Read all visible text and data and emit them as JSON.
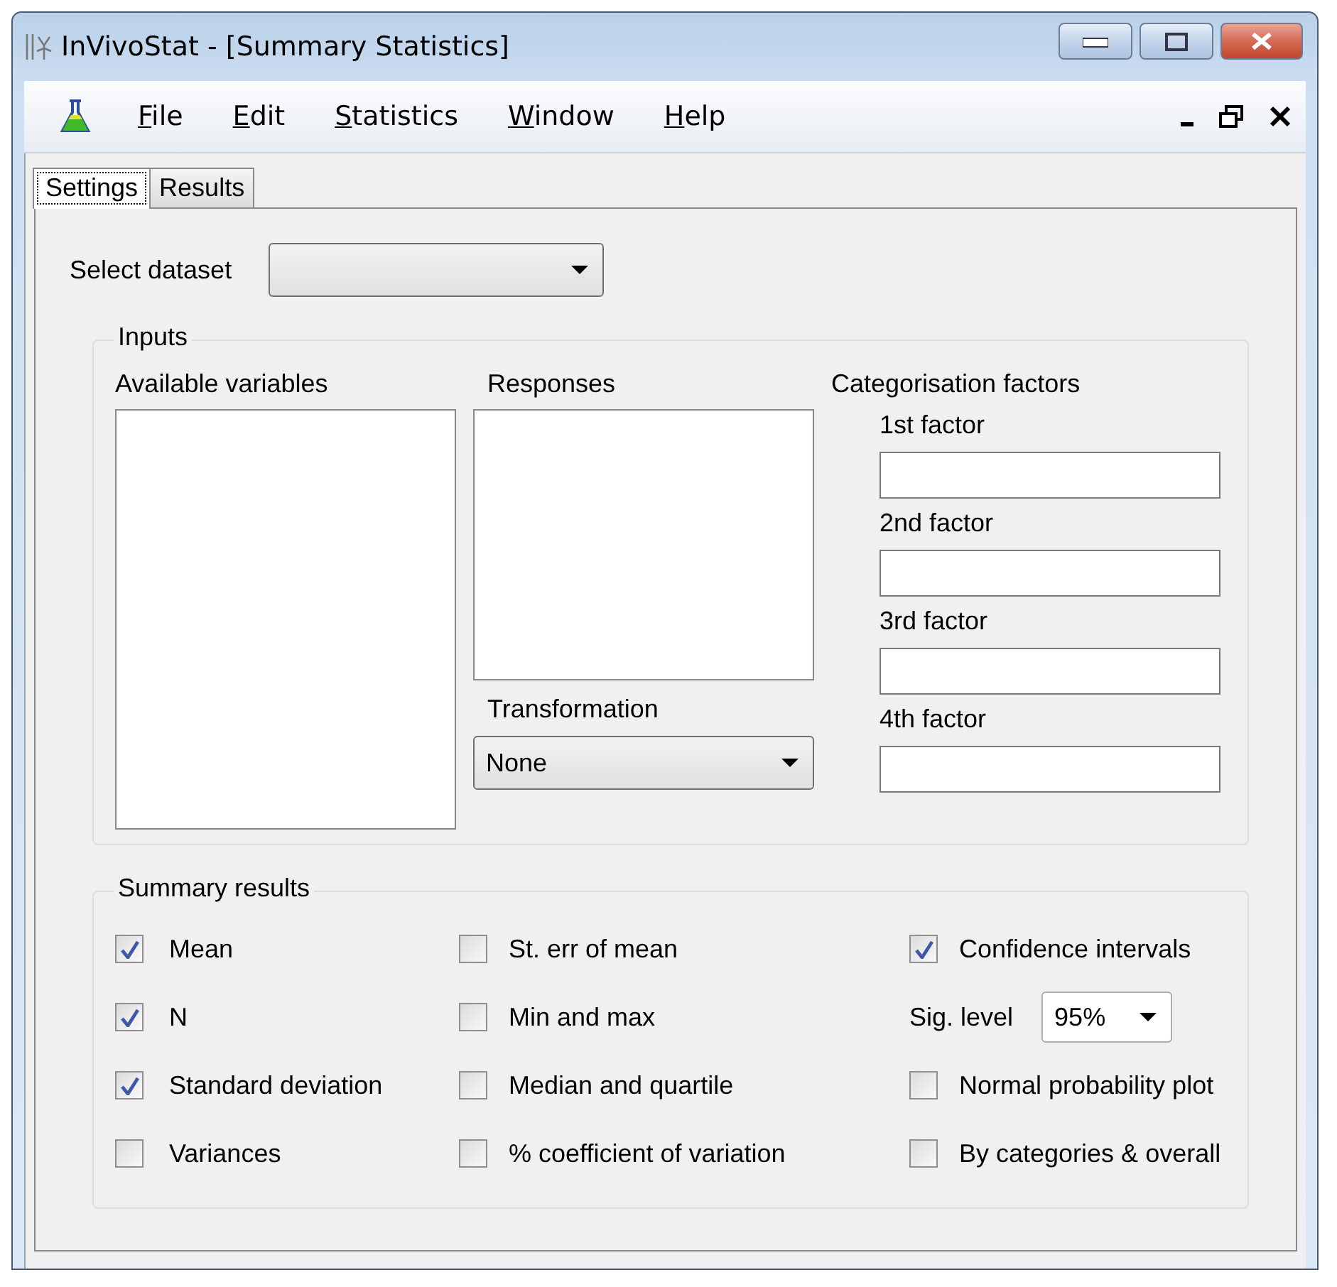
{
  "window": {
    "title": "InVivoStat - [Summary Statistics]"
  },
  "menu": [
    "File",
    "Edit",
    "Statistics",
    "Window",
    "Help"
  ],
  "tabs": [
    {
      "label": "Settings",
      "selected": true
    },
    {
      "label": "Results",
      "selected": false
    }
  ],
  "dataset": {
    "label": "Select dataset"
  },
  "inputs": {
    "title": "Inputs",
    "available_label": "Available variables",
    "responses_label": "Responses",
    "transformation": {
      "label": "Transformation",
      "value": "None"
    },
    "factors_title": "Categorisation factors",
    "factors": [
      "1st factor",
      "2nd factor",
      "3rd factor",
      "4th factor"
    ]
  },
  "summary": {
    "title": "Summary results",
    "columns": [
      [
        {
          "kind": "checkbox",
          "label": "Mean",
          "checked": true
        },
        {
          "kind": "checkbox",
          "label": "N",
          "checked": true
        },
        {
          "kind": "checkbox",
          "label": "Standard deviation",
          "checked": true
        },
        {
          "kind": "checkbox",
          "label": "Variances",
          "checked": false
        }
      ],
      [
        {
          "kind": "checkbox",
          "label": "St. err of mean",
          "checked": false
        },
        {
          "kind": "checkbox",
          "label": "Min and max",
          "checked": false
        },
        {
          "kind": "checkbox",
          "label": "Median and quartile",
          "checked": false
        },
        {
          "kind": "checkbox",
          "label": "% coefficient of variation",
          "checked": false
        }
      ],
      [
        {
          "kind": "checkbox",
          "label": "Confidence intervals",
          "checked": true
        },
        {
          "kind": "select",
          "label": "Sig. level",
          "value": "95%"
        },
        {
          "kind": "checkbox",
          "label": "Normal probability plot",
          "checked": false
        },
        {
          "kind": "checkbox",
          "label": "By categories & overall",
          "checked": false
        }
      ]
    ]
  }
}
